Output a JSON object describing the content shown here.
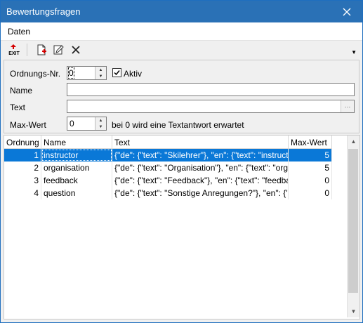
{
  "window": {
    "title": "Bewertungsfragen"
  },
  "menu": {
    "items": [
      "Daten"
    ]
  },
  "toolbar": {
    "exit_label": "EXIT",
    "buttons": [
      "exit-icon",
      "new-document-icon",
      "edit-icon",
      "delete-icon"
    ]
  },
  "form": {
    "order_label": "Ordnungs-Nr.",
    "order_value": "0",
    "active_label": "Aktiv",
    "active_checked": true,
    "name_label": "Name",
    "name_value": "",
    "text_label": "Text",
    "text_value": "",
    "maxvalue_label": "Max-Wert",
    "maxvalue_value": "0",
    "maxvalue_hint": "bei 0 wird eine Textantwort erwartet"
  },
  "grid": {
    "headers": [
      "Ordnung",
      "Name",
      "Text",
      "Max-Wert"
    ],
    "rows": [
      {
        "ordnung": "1",
        "name": "instructor",
        "text": "{\"de\": {\"text\": \"Skilehrer\"}, \"en\": {\"text\": \"instructor\"}}",
        "max": "5",
        "selected": true
      },
      {
        "ordnung": "2",
        "name": "organisation",
        "text": "{\"de\": {\"text\": \"Organisation\"}, \"en\": {\"text\": \"organisation\"}}",
        "max": "5",
        "selected": false
      },
      {
        "ordnung": "3",
        "name": "feedback",
        "text": "{\"de\": {\"text\": \"Feedback\"}, \"en\": {\"text\": \"feedback\"}}",
        "max": "0",
        "selected": false
      },
      {
        "ordnung": "4",
        "name": "question",
        "text": "{\"de\": {\"text\": \"Sonstige Anregungen?\"}, \"en\": {\"text\": \"question\"}}",
        "max": "0",
        "selected": false
      }
    ]
  },
  "colors": {
    "title_bar": "#2a71b6",
    "selection": "#0a78d7",
    "exit_red": "#d40000"
  }
}
